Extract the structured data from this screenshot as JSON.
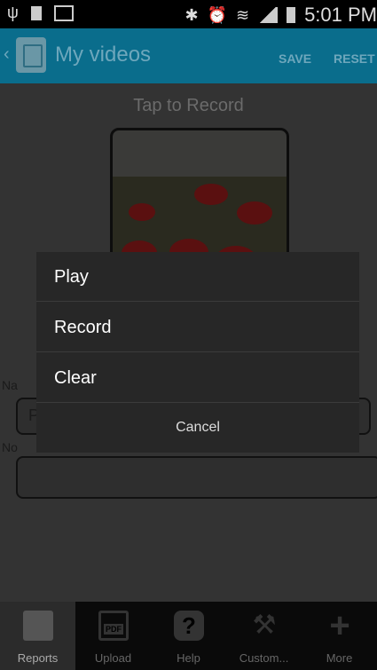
{
  "status": {
    "time": "5:01 PM",
    "battery_small": "100"
  },
  "actionbar": {
    "title": "My videos",
    "save_label": "SAVE",
    "reset_label": "RESET"
  },
  "content": {
    "tap_text": "Tap to Record",
    "name_label": "Na",
    "name_value": "P",
    "notes_label": "No"
  },
  "dialog": {
    "items": [
      {
        "label": "Play"
      },
      {
        "label": "Record"
      },
      {
        "label": "Clear"
      }
    ],
    "cancel_label": "Cancel"
  },
  "tabs": [
    {
      "label": "Reports",
      "icon": "reports-icon"
    },
    {
      "label": "Upload",
      "icon": "pdf-icon",
      "glyph": "PDF"
    },
    {
      "label": "Help",
      "icon": "help-icon",
      "glyph": "?"
    },
    {
      "label": "Custom...",
      "icon": "tools-icon"
    },
    {
      "label": "More",
      "icon": "plus-icon",
      "glyph": "+"
    }
  ]
}
